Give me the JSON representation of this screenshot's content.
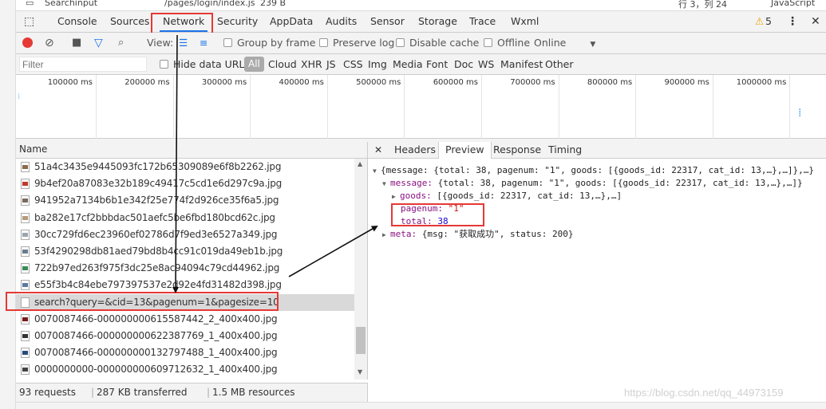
{
  "top_strip": {
    "folder": "Searchinput",
    "file": "/pages/login/index.js",
    "size": "239 B",
    "position": "行 3，列 24",
    "type": "JavaScript"
  },
  "tabs": [
    "Console",
    "Sources",
    "Network",
    "Security",
    "AppData",
    "Audits",
    "Sensor",
    "Storage",
    "Trace",
    "Wxml"
  ],
  "active_tab": "Network",
  "warnings": "5",
  "toolbar": {
    "view_label": "View:",
    "group_by_frame": "Group by frame",
    "preserve_log": "Preserve log",
    "disable_cache": "Disable cache",
    "offline": "Offline",
    "throttle": "Online"
  },
  "filter": {
    "placeholder": "Filter",
    "hide_data_urls": "Hide data URLs",
    "all": "All",
    "types": [
      "Cloud",
      "XHR",
      "JS",
      "CSS",
      "Img",
      "Media",
      "Font",
      "Doc",
      "WS",
      "Manifest",
      "Other"
    ]
  },
  "timeline": {
    "ticks": [
      "100000 ms",
      "200000 ms",
      "300000 ms",
      "400000 ms",
      "500000 ms",
      "600000 ms",
      "700000 ms",
      "800000 ms",
      "900000 ms",
      "1000000 ms"
    ]
  },
  "name_header": "Name",
  "requests": [
    {
      "name": "51a4c3435e9445093fc172b65309089e6f8b2262.jpg",
      "icon": "image-file-icon",
      "selected": false
    },
    {
      "name": "9b4ef20a87083e32b189c49417c5cd1e6d297c9a.jpg",
      "icon": "image-file-icon",
      "selected": false
    },
    {
      "name": "941952a7134b6b1e342f25e774f2d926ce35f6a5.jpg",
      "icon": "image-file-icon",
      "selected": false
    },
    {
      "name": "ba282e17cf2bbbdac501aefc5be6fbd180bcd62c.jpg",
      "icon": "image-file-icon",
      "selected": false
    },
    {
      "name": "30cc729fd6ec23960ef02786d7f9ed3e6527a349.jpg",
      "icon": "image-file-icon",
      "selected": false
    },
    {
      "name": "53f4290298db81aed79bd8b4cc91c019da49eb1b.jpg",
      "icon": "image-file-icon",
      "selected": false
    },
    {
      "name": "722b97ed263f975f3dc25e8ac94094c79cd44962.jpg",
      "icon": "image-file-icon",
      "selected": false
    },
    {
      "name": "e55f3b4c84ebe797397537e2d92e4fd31482d398.jpg",
      "icon": "image-file-icon",
      "selected": false
    },
    {
      "name": "search?query=&cid=13&pagenum=1&pagesize=10",
      "icon": "document-file-icon",
      "selected": true
    },
    {
      "name": "0070087466-000000000615587442_2_400x400.jpg",
      "icon": "image-file-icon",
      "selected": false
    },
    {
      "name": "0070087466-000000000622387769_1_400x400.jpg",
      "icon": "image-file-icon",
      "selected": false
    },
    {
      "name": "0070087466-000000000132797488_1_400x400.jpg",
      "icon": "image-file-icon",
      "selected": false
    },
    {
      "name": "0000000000-000000000609712632_1_400x400.jpg",
      "icon": "image-file-icon",
      "selected": false
    }
  ],
  "status": {
    "requests": "93 requests",
    "transferred": "287 KB transferred",
    "resources": "1.5 MB resources"
  },
  "detail_tabs": [
    "Headers",
    "Preview",
    "Response",
    "Timing"
  ],
  "active_detail_tab": "Preview",
  "preview": {
    "line1": "{message: {total: 38, pagenum: \"1\", goods: [{goods_id: 22317, cat_id: 13,…},…]},…}",
    "line2_key": "message:",
    "line2_val": "{total: 38, pagenum: \"1\", goods: [{goods_id: 22317, cat_id: 13,…},…]}",
    "line3_key": "goods:",
    "line3_val": "[{goods_id: 22317, cat_id: 13,…},…]",
    "pagenum_key": "pagenum:",
    "pagenum_val": "\"1\"",
    "total_key": "total:",
    "total_val": "38",
    "meta_key": "meta:",
    "meta_val": "{msg: \"获取成功\", status: 200}"
  },
  "watermark": "https://blog.csdn.net/qq_44973159",
  "colors": {
    "highlight": "#e53935",
    "accent": "#1a73e8",
    "record": "#e53935"
  }
}
